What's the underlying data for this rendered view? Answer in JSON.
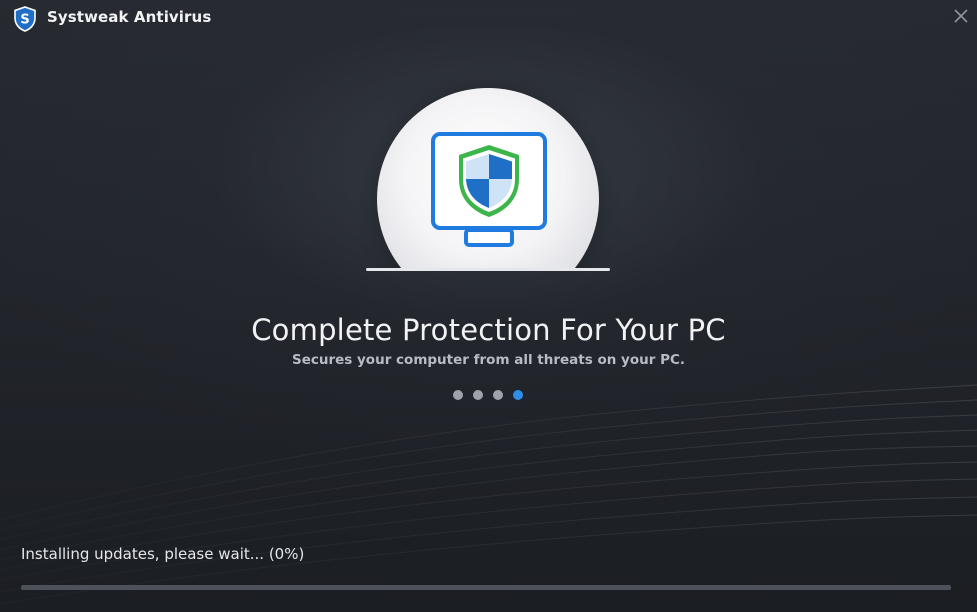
{
  "app": {
    "title": "Systweak Antivirus",
    "logo_icon": "shield-s-logo-icon",
    "close_icon": "close-icon"
  },
  "slide": {
    "icon": "monitor-shield-icon",
    "headline": "Complete Protection For Your PC",
    "subtitle": "Secures your computer from all threats on your PC.",
    "total_slides": 4,
    "active_slide": 4
  },
  "status": {
    "message": "Installing updates, please wait... (0%)",
    "progress_fraction": 0
  },
  "colors": {
    "accent": "#2f8ee8",
    "background": "#22252b",
    "shield_green": "#3cb54a",
    "shield_blue": "#1f6fc7",
    "monitor_blue": "#1f7be0"
  }
}
